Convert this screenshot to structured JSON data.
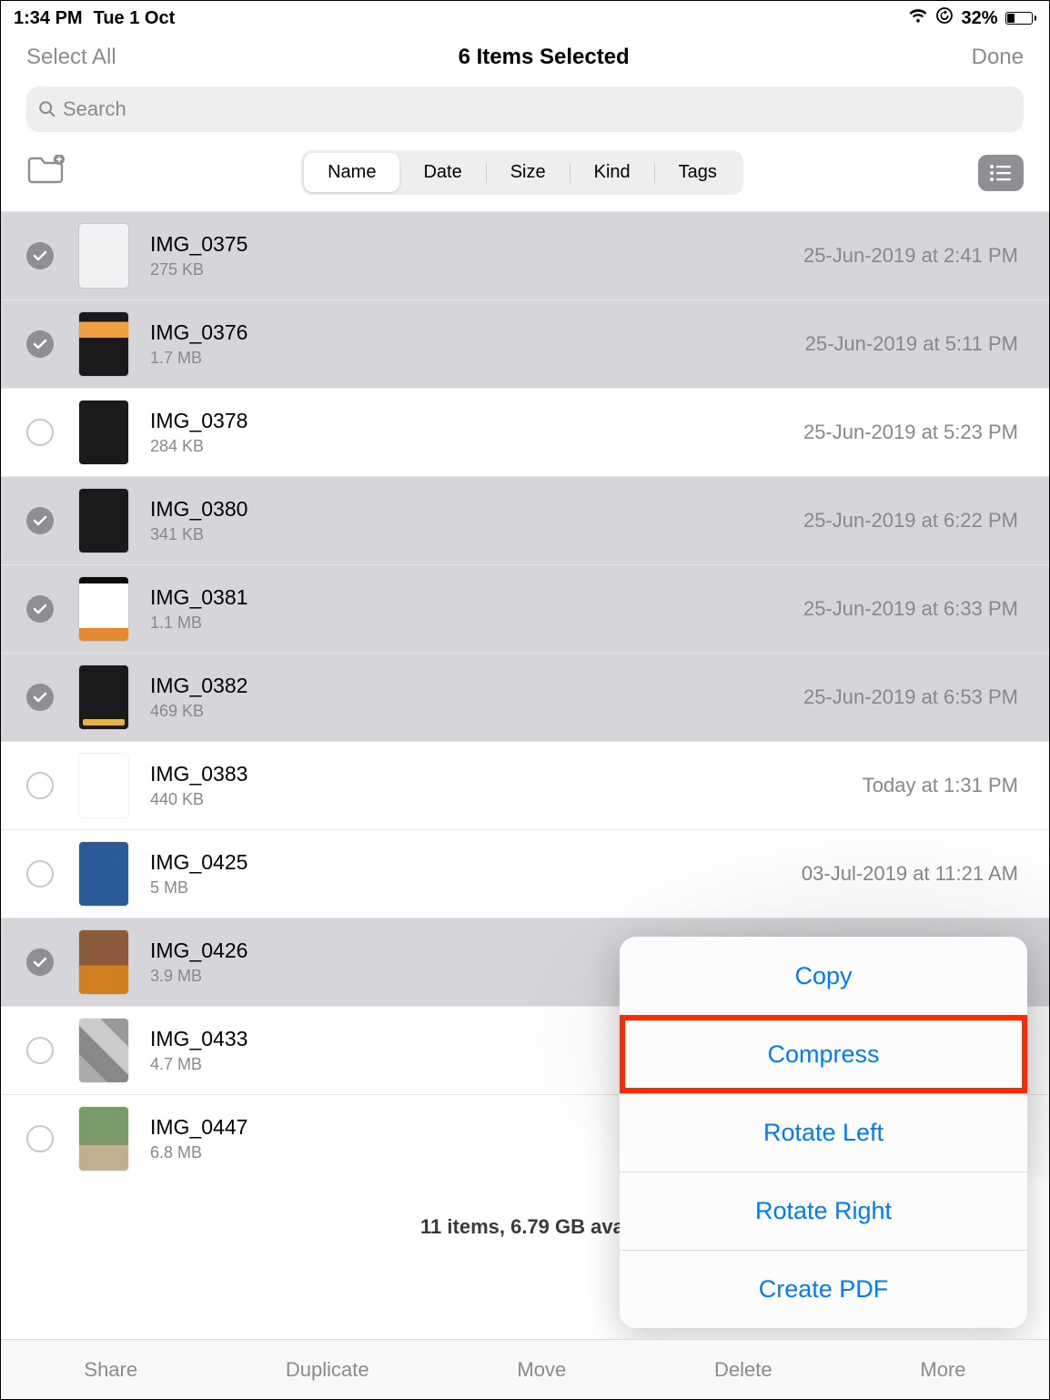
{
  "status": {
    "time": "1:34 PM",
    "date": "Tue 1 Oct",
    "battery_pct": "32%"
  },
  "nav": {
    "select_all": "Select All",
    "title": "6 Items Selected",
    "done": "Done"
  },
  "search": {
    "placeholder": "Search"
  },
  "sort": {
    "items": [
      "Name",
      "Date",
      "Size",
      "Kind",
      "Tags"
    ],
    "active": "Name"
  },
  "files": [
    {
      "name": "IMG_0375",
      "size": "275 KB",
      "date": "25-Jun-2019 at 2:41 PM",
      "selected": true,
      "thumb": "light"
    },
    {
      "name": "IMG_0376",
      "size": "1.7 MB",
      "date": "25-Jun-2019 at 5:11 PM",
      "selected": true,
      "thumb": "mixed"
    },
    {
      "name": "IMG_0378",
      "size": "284 KB",
      "date": "25-Jun-2019 at 5:23 PM",
      "selected": false,
      "thumb": "dark"
    },
    {
      "name": "IMG_0380",
      "size": "341 KB",
      "date": "25-Jun-2019 at 6:22 PM",
      "selected": true,
      "thumb": "dark"
    },
    {
      "name": "IMG_0381",
      "size": "1.1 MB",
      "date": "25-Jun-2019 at 6:33 PM",
      "selected": true,
      "thumb": "chart"
    },
    {
      "name": "IMG_0382",
      "size": "469 KB",
      "date": "25-Jun-2019 at 6:53 PM",
      "selected": true,
      "thumb": "form"
    },
    {
      "name": "IMG_0383",
      "size": "440 KB",
      "date": "Today at 1:31 PM",
      "selected": false,
      "thumb": "sketch"
    },
    {
      "name": "IMG_0425",
      "size": "5 MB",
      "date": "03-Jul-2019 at 11:21 AM",
      "selected": false,
      "thumb": "photo1"
    },
    {
      "name": "IMG_0426",
      "size": "3.9 MB",
      "date": "",
      "selected": true,
      "thumb": "photo2"
    },
    {
      "name": "IMG_0433",
      "size": "4.7 MB",
      "date": "",
      "selected": false,
      "thumb": "grid"
    },
    {
      "name": "IMG_0447",
      "size": "6.8 MB",
      "date": "",
      "selected": false,
      "thumb": "outdoor"
    }
  ],
  "summary": "11 items, 6.79 GB avai",
  "bottom": {
    "share": "Share",
    "duplicate": "Duplicate",
    "move": "Move",
    "delete": "Delete",
    "more": "More"
  },
  "popover": {
    "items": [
      "Copy",
      "Compress",
      "Rotate Left",
      "Rotate Right",
      "Create PDF"
    ],
    "highlighted": "Compress"
  }
}
